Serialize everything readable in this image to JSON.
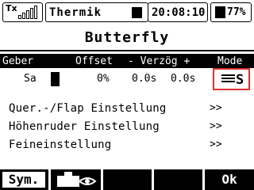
{
  "status": {
    "tx_label": "Tx",
    "model_name": "Thermik",
    "time": "20:08:10",
    "battery": "77%",
    "battery_level": 0.77,
    "signal_level": 0
  },
  "page": {
    "title": "Butterfly"
  },
  "table": {
    "headers": [
      "Geber",
      "Offset",
      "- Verzög +",
      "Mode"
    ],
    "row": {
      "geber": "Sa",
      "offset": "0%",
      "delay_minus": "0.0s",
      "delay_plus": "0.0s",
      "mode": "S"
    }
  },
  "menu": [
    {
      "label": "Quer.-/Flap Einstellung",
      "arrow": ">>"
    },
    {
      "label": "Höhenruder Einstellung",
      "arrow": ">>"
    },
    {
      "label": "Feineinstellung",
      "arrow": ">>"
    }
  ],
  "softkeys": {
    "key1": "Sym.",
    "key6": "Ok"
  },
  "colors": {
    "highlight": "#e03030"
  }
}
